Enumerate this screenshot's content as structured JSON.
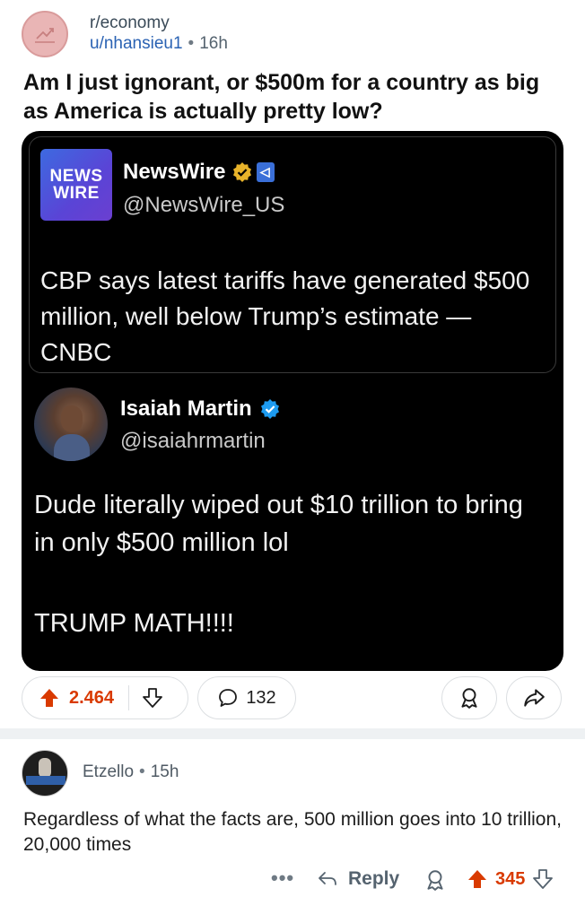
{
  "post": {
    "subreddit": "r/economy",
    "author": "u/nhansieu1",
    "separator": "•",
    "age": "16h",
    "title": "Am I just ignorant, or $500m for a country as big as America is actually pretty low?"
  },
  "embedded_image": {
    "quoted": {
      "logo_line1": "NEWS",
      "logo_line2": "WIRE",
      "name": "NewsWire",
      "handle": "@NewsWire_US",
      "text": "CBP says latest tariffs have generated $500 million, well below Trump’s estimate — CNBC"
    },
    "reply": {
      "name": "Isaiah Martin",
      "handle": "@isaiahrmartin",
      "text": "Dude literally wiped out $10 trillion to bring in only $500 million lol",
      "text2": "TRUMP MATH!!!!"
    }
  },
  "actions": {
    "upvotes": "2.464",
    "comments": "132"
  },
  "comment": {
    "author": "Etzello",
    "separator": "•",
    "age": "15h",
    "body": "Regardless of what the facts are, 500 million goes into 10 trillion, 20,000 times",
    "more": "•••",
    "reply_label": "Reply",
    "upvotes": "345"
  },
  "colors": {
    "upvote_accent": "#d93a00",
    "link_blue": "#2a62b3",
    "tweet_bg": "#000000"
  },
  "icons": [
    "trend-icon",
    "gold-check-icon",
    "gov-badge-icon",
    "blue-check-icon",
    "upvote-icon",
    "downvote-icon",
    "comment-icon",
    "award-icon",
    "share-icon",
    "reply-icon"
  ]
}
